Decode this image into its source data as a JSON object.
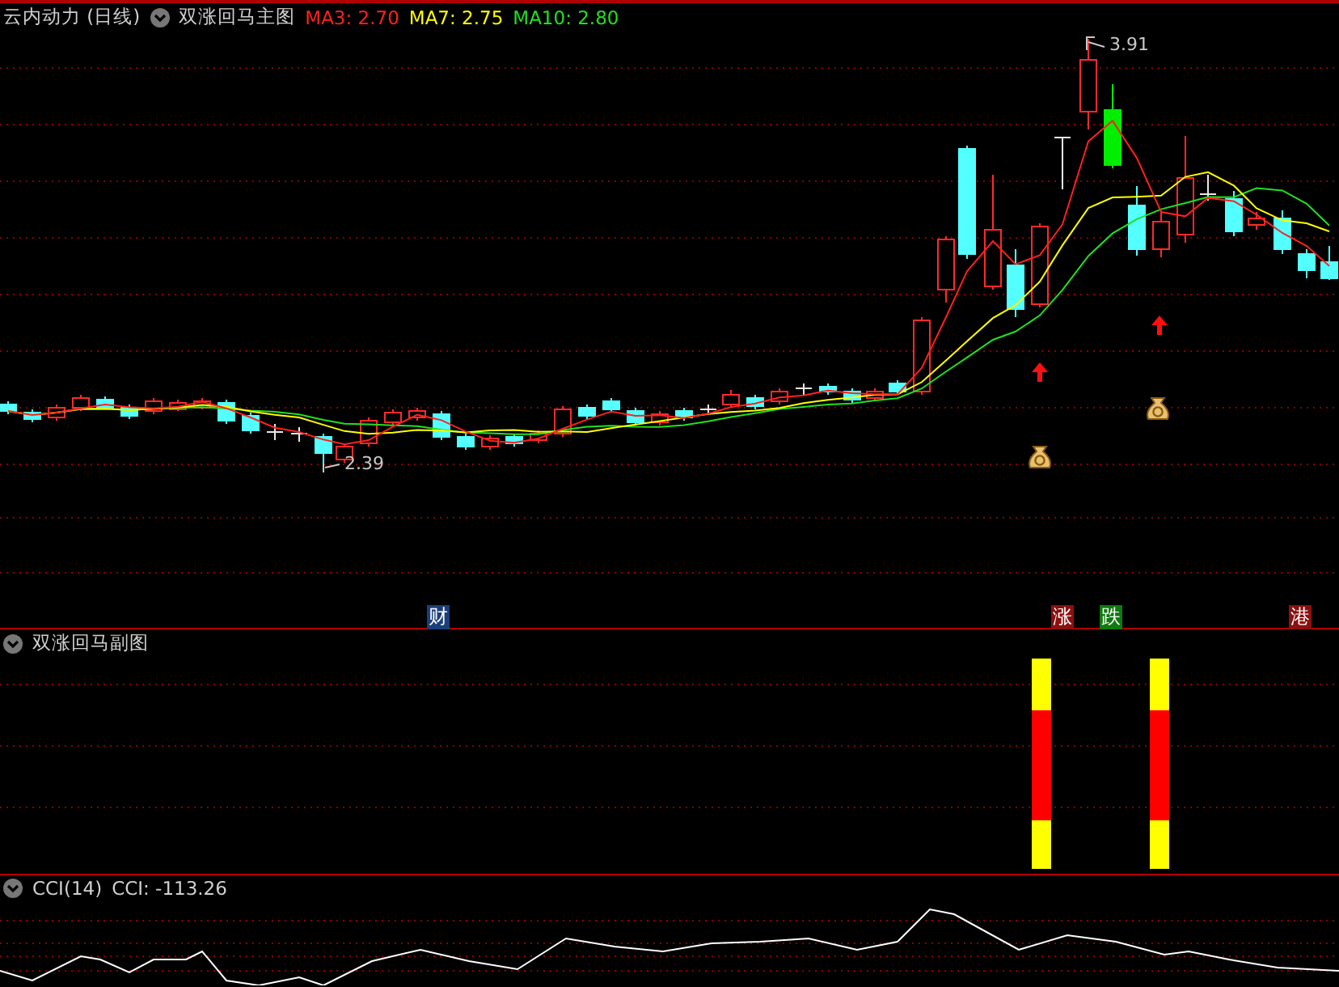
{
  "main_pane": {
    "stock": "云内动力 (日线)",
    "indicator": "双涨回马主图",
    "ma": [
      {
        "label": "MA3: 2.70",
        "color": "#ff2020"
      },
      {
        "label": "MA7: 2.75",
        "color": "#ffff00"
      },
      {
        "label": "MA10: 2.80",
        "color": "#20e020"
      }
    ],
    "high_label": "3.91",
    "low_label": "2.39",
    "tags": [
      {
        "text": "财",
        "color": "#1c3f7a"
      },
      {
        "text": "涨",
        "color": "#8b1010"
      },
      {
        "text": "跌",
        "color": "#107a10"
      },
      {
        "text": "港",
        "color": "#8b1010"
      }
    ]
  },
  "sub_pane": {
    "title": "双涨回马副图"
  },
  "cci_pane": {
    "name": "CCI(14)",
    "reading": "CCI: -113.26"
  }
}
